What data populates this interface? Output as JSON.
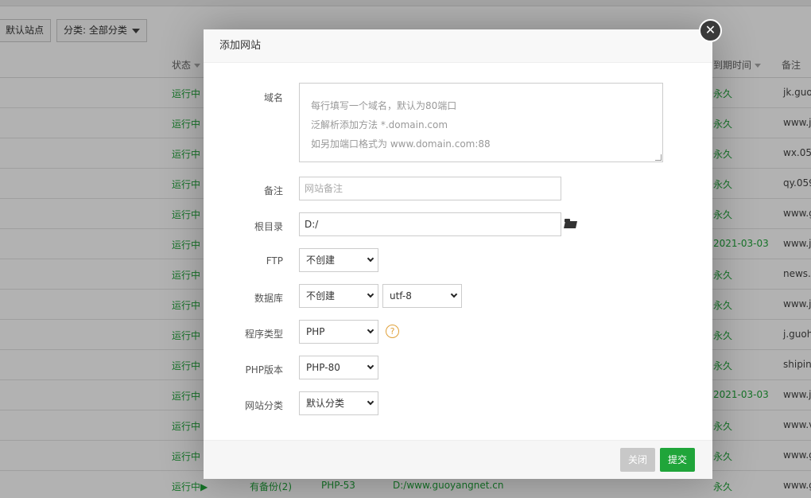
{
  "toolbar": {
    "default_site_label": "默认站点",
    "category_label": "分类: 全部分类"
  },
  "table": {
    "headers": {
      "status": "状态",
      "expire": "到期时间",
      "note": "备注"
    },
    "rows": [
      {
        "status": "运行中",
        "expire": "永久",
        "note": "jk.guo"
      },
      {
        "status": "运行中",
        "expire": "永久",
        "note": "www.j"
      },
      {
        "status": "运行中",
        "expire": "永久",
        "note": "wx.059"
      },
      {
        "status": "运行中",
        "expire": "永久",
        "note": "qy.059"
      },
      {
        "status": "运行中",
        "expire": "永久",
        "note": "www.g"
      },
      {
        "status": "运行中",
        "expire": "2021-03-03",
        "note": "www.j"
      },
      {
        "status": "运行中",
        "expire": "永久",
        "note": "news.0"
      },
      {
        "status": "运行中",
        "expire": "永久",
        "note": "www.j"
      },
      {
        "status": "运行中",
        "expire": "永久",
        "note": "j.guoh"
      },
      {
        "status": "运行中",
        "expire": "永久",
        "note": "shipin"
      },
      {
        "status": "运行中",
        "expire": "2021-03-03",
        "note": "www.j"
      },
      {
        "status": "运行中",
        "expire": "永久",
        "note": "www.v"
      },
      {
        "status": "运行中",
        "expire": "永久",
        "note": "www.g"
      },
      {
        "status": "运行中▶",
        "backup": "有备份(2)",
        "php": "PHP-53",
        "path": "D:/www.guoyangnet.cn",
        "expire": "永久",
        "note": "www.g"
      }
    ]
  },
  "modal": {
    "title": "添加网站",
    "close_icon": "✕",
    "domain": {
      "label": "域名",
      "placeholder_lines": [
        "每行填写一个域名，默认为80端口",
        "泛解析添加方法 *.domain.com",
        "如另加端口格式为 www.domain.com:88"
      ]
    },
    "remark": {
      "label": "备注",
      "placeholder": "网站备注"
    },
    "root": {
      "label": "根目录",
      "value": "D:/"
    },
    "ftp": {
      "label": "FTP",
      "value": "不创建"
    },
    "database": {
      "label": "数据库",
      "value": "不创建",
      "charset": "utf-8"
    },
    "program_type": {
      "label": "程序类型",
      "value": "PHP",
      "help": "?"
    },
    "php_version": {
      "label": "PHP版本",
      "value": "PHP-80"
    },
    "site_category": {
      "label": "网站分类",
      "value": "默认分类"
    },
    "buttons": {
      "close": "关闭",
      "submit": "提交"
    }
  }
}
